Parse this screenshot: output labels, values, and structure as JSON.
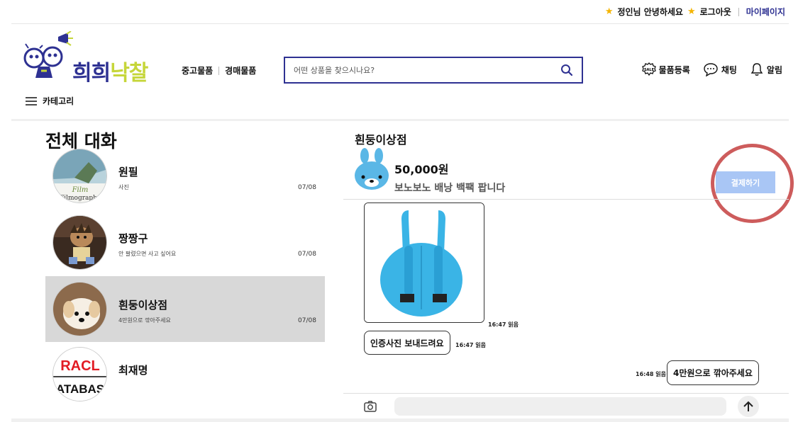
{
  "topbar": {
    "greeting": "정인님 안녕하세요",
    "logout": "로그아웃",
    "mypage": "마이페이지"
  },
  "header": {
    "logo_part1": "희희",
    "logo_part2": "낙찰",
    "nav": [
      "중고물품",
      "경매물품"
    ],
    "search_placeholder": "어떤 상품을 찾으시나요?",
    "actions": {
      "register": "물품등록",
      "chat": "채팅",
      "alarm": "알림"
    },
    "category": "카테고리"
  },
  "chat_list": {
    "title": "전체 대화",
    "items": [
      {
        "name": "원필",
        "last": "사진",
        "date": "07/08"
      },
      {
        "name": "짱짱구",
        "last": "안 팔렸으면 사고 싶어요",
        "date": "07/08"
      },
      {
        "name": "흰둥이상점",
        "last": "4만원으로 깎아주세요",
        "date": "07/08"
      },
      {
        "name": "최재명",
        "last": "",
        "date": ""
      }
    ],
    "avatar_texts": {
      "film_1": "Film",
      "film_2": "Filmography",
      "oracle_1": "RACL",
      "oracle_2": "ATABAS"
    }
  },
  "conversation": {
    "title": "흰둥이상점",
    "product": {
      "price": "50,000원",
      "name": "보노보노 배낭 백팩 팝니다"
    },
    "pay_button": "결제하기",
    "messages": [
      {
        "type": "image",
        "time": "16:47 읽음"
      },
      {
        "type": "text",
        "text": "인증사진 보내드려요",
        "time": "16:47 읽음"
      },
      {
        "type": "text",
        "text": "4만원으로 깎아주세요",
        "time": "16:48 읽음"
      }
    ]
  },
  "colors": {
    "brand": "#2e3192",
    "brand_accent": "#c6d63a",
    "pay_button": "#a9c6f5",
    "highlight_circle": "#cd5c5c",
    "active_row": "#d8d8d8",
    "backpack": "#3ab4e6"
  }
}
